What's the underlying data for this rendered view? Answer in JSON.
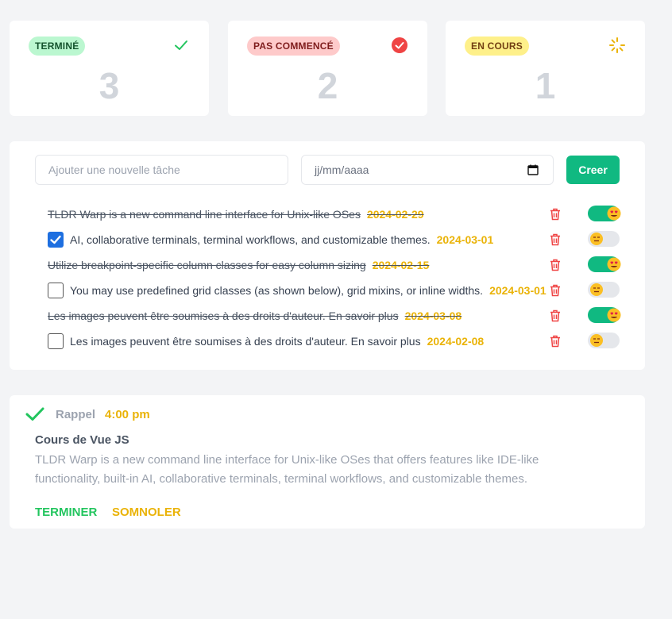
{
  "stats": [
    {
      "label": "TERMINÉ",
      "count": "3",
      "icon": "check-icon",
      "color": "#22c55e"
    },
    {
      "label": "PAS COMMENCÉ",
      "count": "2",
      "icon": "check-circle-icon",
      "color": "#ef4444"
    },
    {
      "label": "EN COURS",
      "count": "1",
      "icon": "loading-spinner-icon",
      "color": "#eab308"
    }
  ],
  "form": {
    "task_placeholder": "Ajouter une nouvelle tâche",
    "date_placeholder": "jj/mm/aaaa",
    "create_label": "Creer"
  },
  "tasks": [
    {
      "text": "TLDR Warp is a new command line interface for Unix-like OSes",
      "date": "2024-02-29",
      "done": true,
      "toggle": "on"
    },
    {
      "text": "AI, collaborative terminals, terminal workflows, and customizable themes.",
      "date": "2024-03-01",
      "done": false,
      "checked": true,
      "toggle": "off"
    },
    {
      "text": "Utilize breakpoint-specific column classes for easy column sizing",
      "date": "2024-02-15",
      "done": true,
      "toggle": "on"
    },
    {
      "text": "You may use predefined grid classes (as shown below), grid mixins, or inline widths.",
      "date": "2024-03-01",
      "done": false,
      "checked": false,
      "toggle": "off"
    },
    {
      "text": "Les images peuvent être soumises à des droits d'auteur. En savoir plus",
      "date": "2024-03-08",
      "done": true,
      "toggle": "on"
    },
    {
      "text": "Les images peuvent être soumises à des droits d'auteur. En savoir plus",
      "date": "2024-02-08",
      "done": false,
      "checked": false,
      "toggle": "off"
    }
  ],
  "reminder": {
    "label": "Rappel",
    "time": "4:00 pm",
    "title": "Cours de Vue JS",
    "description": "TLDR Warp is a new command line interface for Unix-like OSes that offers features like IDE-like functionality, built-in AI, collaborative terminals, terminal workflows, and customizable themes.",
    "finish_label": "TERMINER",
    "snooze_label": "SOMNOLER"
  }
}
